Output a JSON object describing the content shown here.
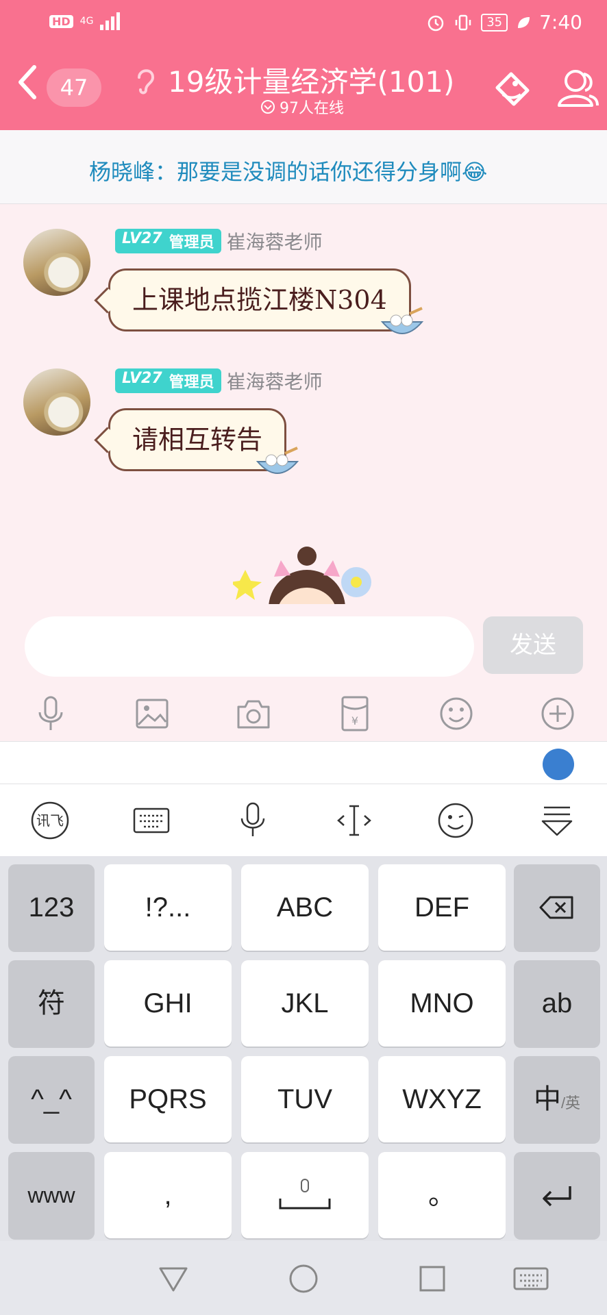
{
  "status_bar": {
    "network": "4G",
    "battery": "35",
    "time": "7:40"
  },
  "header": {
    "unread_count": "47",
    "title": "19级计量经济学(101)",
    "online": "97人在线",
    "background_color": "#f9718f"
  },
  "announcement": {
    "text": "杨晓峰：那要是没调的话你还得分身啊😂"
  },
  "messages": [
    {
      "level": "LV27",
      "role": "管理员",
      "sender": "崔海蓉老师",
      "text": "上课地点揽江楼N304"
    },
    {
      "level": "LV27",
      "role": "管理员",
      "sender": "崔海蓉老师",
      "text": "请相互转告"
    }
  ],
  "composer": {
    "placeholder": "",
    "send_label": "发送"
  },
  "toolbar_icons": [
    "mic-icon",
    "image-icon",
    "camera-icon",
    "red-packet-icon",
    "emoji-icon",
    "plus-icon"
  ],
  "ime_icons": [
    "xunfei-logo-icon",
    "keyboard-icon",
    "mic-icon",
    "cursor-icon",
    "emoji-icon",
    "collapse-icon"
  ],
  "keyboard": {
    "rows": [
      [
        "123",
        "!?...",
        "ABC",
        "DEF",
        "⌫"
      ],
      [
        "符",
        "GHI",
        "JKL",
        "MNO",
        "ab"
      ],
      [
        "^_^",
        "PQRS",
        "TUV",
        "WXYZ",
        "中"
      ],
      [
        "www",
        ",",
        "␣",
        "。",
        "↵"
      ]
    ],
    "lang_sub": "/英"
  },
  "nav_icons": [
    "back-triangle-icon",
    "home-circle-icon",
    "recents-square-icon",
    "keyboard-hide-icon"
  ]
}
